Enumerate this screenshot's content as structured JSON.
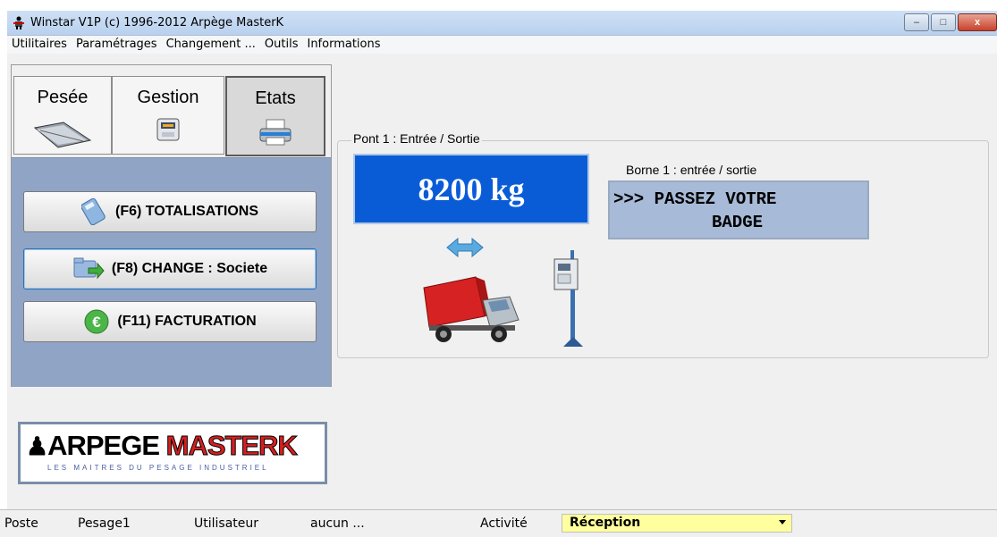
{
  "window": {
    "title": "Winstar V1P (c) 1996-2012 Arpège MasterK",
    "buttons": {
      "minimize": "–",
      "maximize": "□",
      "close": "x"
    }
  },
  "menu": [
    "Utilitaires",
    "Paramétrages",
    "Changement ...",
    "Outils",
    "Informations"
  ],
  "tabs": [
    {
      "label": "Pesée",
      "icon": "scale-platform-icon"
    },
    {
      "label": "Gestion",
      "icon": "terminal-icon"
    },
    {
      "label": "Etats",
      "icon": "printer-icon",
      "active": true
    }
  ],
  "actions": [
    {
      "label": "(F6) TOTALISATIONS",
      "icon": "calculator-icon"
    },
    {
      "label": "(F8) CHANGE : Societe",
      "icon": "folder-arrow-icon",
      "focused": true
    },
    {
      "label": "(F11) FACTURATION",
      "icon": "euro-icon"
    }
  ],
  "logo": {
    "main": "ARPEGE MASTERK",
    "tagline": "LES MAITRES DU PESAGE INDUSTRIEL"
  },
  "pont": {
    "label": "Pont 1 : Entrée / Sortie",
    "weight": "8200 kg",
    "borne_label": "Borne 1 : entrée / sortie",
    "borne_line1": ">>> PASSEZ VOTRE",
    "borne_line2": "BADGE"
  },
  "status": {
    "poste_label": "Poste",
    "poste_value": "Pesage1",
    "user_label": "Utilisateur",
    "user_value": "aucun ...",
    "activity_label": "Activité",
    "activity_value": "Réception"
  },
  "colors": {
    "weight_bg": "#0a5cd6",
    "panel_bg": "#90a4c6",
    "activity_bg": "#ffff9e"
  }
}
